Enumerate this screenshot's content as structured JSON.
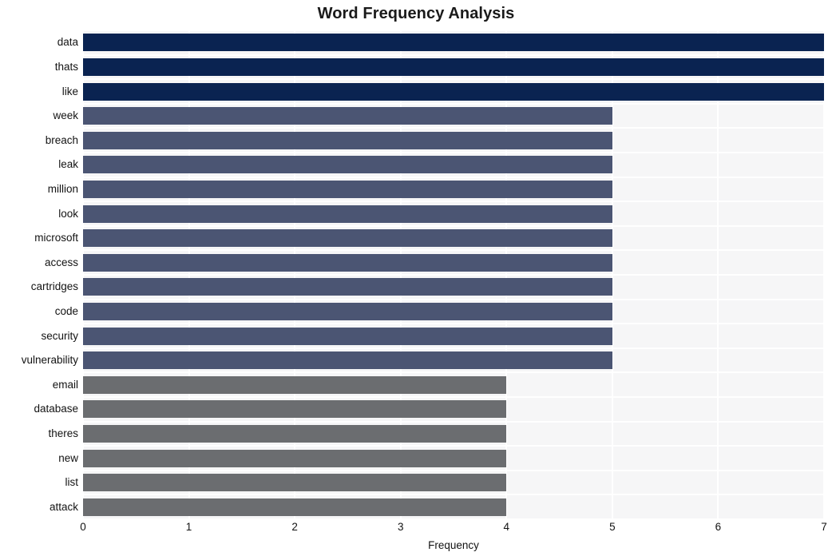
{
  "chart_data": {
    "type": "bar",
    "orientation": "horizontal",
    "title": "Word Frequency Analysis",
    "xlabel": "Frequency",
    "ylabel": "",
    "xlim": [
      0,
      7
    ],
    "xticks": [
      0,
      1,
      2,
      3,
      4,
      5,
      6,
      7
    ],
    "xticklabels": [
      "0",
      "1",
      "2",
      "3",
      "4",
      "5",
      "6",
      "7"
    ],
    "grid": true,
    "grid_color": "#ffffff",
    "panel_background": "#f6f6f7",
    "legend": "none",
    "categories": [
      "data",
      "thats",
      "like",
      "week",
      "breach",
      "leak",
      "million",
      "look",
      "microsoft",
      "access",
      "cartridges",
      "code",
      "security",
      "vulnerability",
      "email",
      "database",
      "theres",
      "new",
      "list",
      "attack"
    ],
    "values": [
      7,
      7,
      7,
      5,
      5,
      5,
      5,
      5,
      5,
      5,
      5,
      5,
      5,
      5,
      4,
      4,
      4,
      4,
      4,
      4
    ],
    "bar_colors": [
      "#0a2351",
      "#0a2351",
      "#0a2351",
      "#4b5573",
      "#4b5573",
      "#4b5573",
      "#4b5573",
      "#4b5573",
      "#4b5573",
      "#4b5573",
      "#4b5573",
      "#4b5573",
      "#4b5573",
      "#4b5573",
      "#6b6d70",
      "#6b6d70",
      "#6b6d70",
      "#6b6d70",
      "#6b6d70",
      "#6b6d70"
    ],
    "color_scale": {
      "high": "#0a2351",
      "mid": "#4b5573",
      "low": "#6b6d70"
    }
  }
}
